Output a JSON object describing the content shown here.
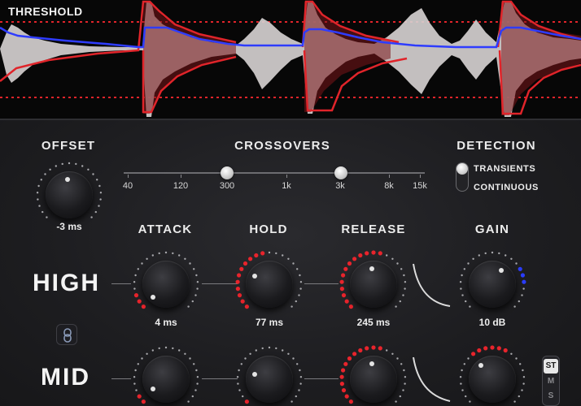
{
  "display": {
    "threshold_label": "THRESHOLD"
  },
  "offset": {
    "title": "OFFSET",
    "value": "-3 ms"
  },
  "crossovers": {
    "title": "CROSSOVERS",
    "scale": [
      "40",
      "120",
      "300",
      "1k",
      "3k",
      "8k",
      "15k"
    ],
    "low_value": "300",
    "high_value": "3k"
  },
  "detection": {
    "title": "DETECTION",
    "options": [
      "TRANSIENTS",
      "CONTINUOUS"
    ],
    "selected": "TRANSIENTS"
  },
  "columns": {
    "attack": "ATTACK",
    "hold": "HOLD",
    "release": "RELEASE",
    "gain": "GAIN"
  },
  "bands": {
    "high": {
      "label": "HIGH",
      "attack": "4 ms",
      "hold": "77 ms",
      "release": "245 ms",
      "gain": "10 dB"
    },
    "mid": {
      "label": "MID"
    }
  },
  "stereo_mode": {
    "options": [
      "ST",
      "M",
      "S"
    ],
    "selected": "ST"
  },
  "colors": {
    "accent_red": "#e8242c",
    "accent_blue": "#2a3cff",
    "envelope_blue": "#2e3cff",
    "threshold_red": "#e0242a"
  }
}
